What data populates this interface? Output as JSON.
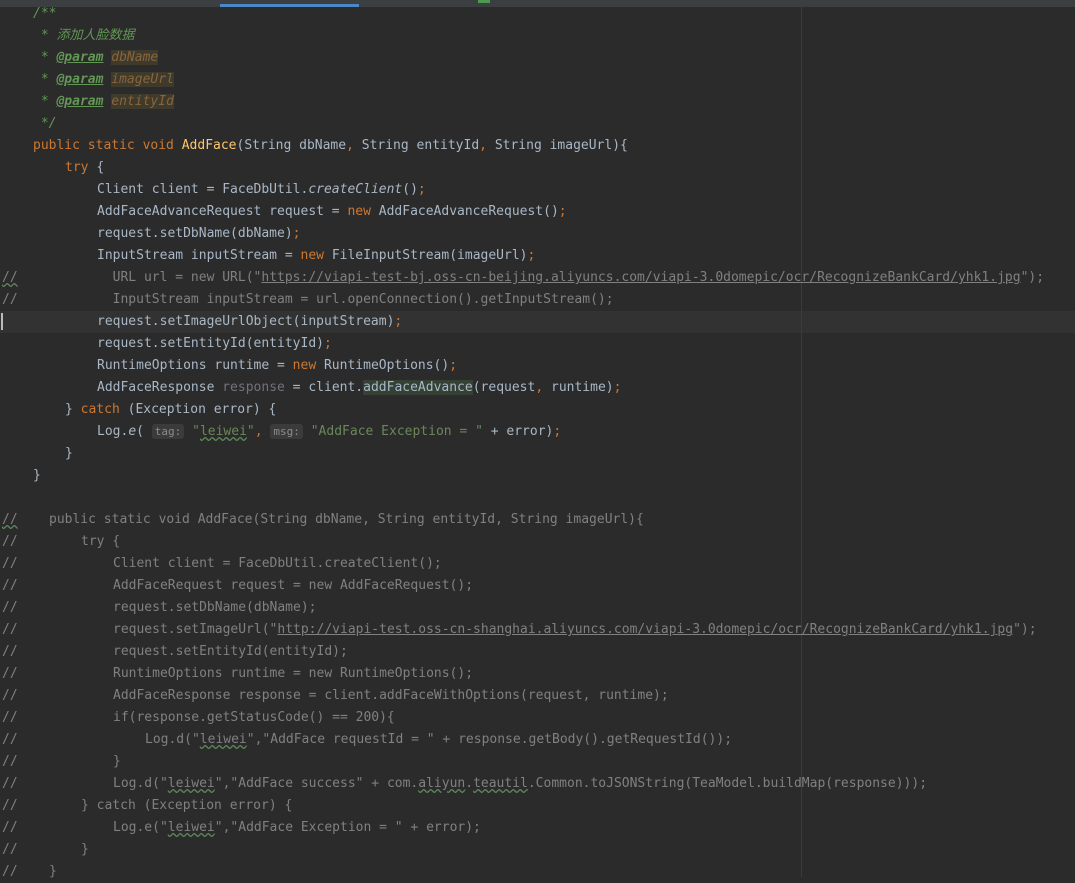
{
  "colors": {
    "background": "#2b2b2b",
    "keyword": "#cc7832",
    "function": "#ffc66d",
    "string": "#6a8759",
    "comment": "#808080",
    "doc": "#629755",
    "default": "#a9b7c6"
  },
  "code": {
    "doc_open": "/**",
    "doc_desc_prefix": " * ",
    "doc_desc": "添加人脸数据",
    "doc_star": " * ",
    "param_tag": "@param",
    "param1": "dbName",
    "param2": "imageUrl",
    "param3": "entityId",
    "doc_close": " */",
    "l6_kw": "public static void ",
    "l6_fn": "AddFace",
    "l6_a": "(String dbName",
    "l6_c1": ", ",
    "l6_b": "String entityId",
    "l6_c2": ", ",
    "l6_d": "String imageUrl){",
    "l7_kw": "try ",
    "l7_b": "{",
    "l8_a": "Client client = FaceDbUtil.",
    "l8_b": "createClient",
    "l8_c": "()",
    "l8_s": ";",
    "l9_a": "AddFaceAdvanceRequest request = ",
    "l9_kw": "new ",
    "l9_b": "AddFaceAdvanceRequest()",
    "l9_s": ";",
    "l10_a": "request.setDbName(dbName)",
    "l10_s": ";",
    "l11_a": "InputStream inputStream = ",
    "l11_kw": "new ",
    "l11_b": "FileInputStream(imageUrl)",
    "l11_s": ";",
    "l12_g": "//",
    "l12_a": "  URL url = new URL(\"",
    "l12_link": "https://viapi-test-bj.oss-cn-beijing.aliyuncs.com/viapi-3.0domepic/ocr/RecognizeBankCard/yhk1.jpg",
    "l12_b": "\");",
    "l13_g": "//",
    "l13_a": "  InputStream inputStream = url.openConnection().getInputStream();",
    "l14_a": "request.setImageUrlObject(inputStream)",
    "l14_s": ";",
    "l15_a": "request.setEntityId(entityId)",
    "l15_s": ";",
    "l16_a": "RuntimeOptions runtime = ",
    "l16_kw": "new ",
    "l16_b": "RuntimeOptions()",
    "l16_s": ";",
    "l17_a": "AddFaceResponse ",
    "l17_unused": "response",
    "l17_b": " = client.",
    "l17_hl": "addFaceAdvance",
    "l17_c": "(request",
    "l17_comma": ", ",
    "l17_d": "runtime)",
    "l17_s": ";",
    "l18_a": "} ",
    "l18_kw": "catch ",
    "l18_b": "(Exception error) {",
    "l19_a": "Log.",
    "l19_e": "e",
    "l19_b": "( ",
    "l19_hint1": "tag:",
    "l19_sp1": " ",
    "l19_q1": "\"",
    "l19_s1": "leiwei",
    "l19_q2": "\"",
    "l19_comma": ", ",
    "l19_hint2": "msg:",
    "l19_sp2": " ",
    "l19_s2": "\"AddFace Exception = \"",
    "l19_c": " + error)",
    "l19_s": ";",
    "l20": "}",
    "l21": "}",
    "c_gut": "//",
    "c1": "public static void AddFace(String dbName, String entityId, String imageUrl){",
    "c2": "try {",
    "c3": "Client client = FaceDbUtil.createClient();",
    "c4": "AddFaceRequest request = new AddFaceRequest();",
    "c5": "request.setDbName(dbName);",
    "c6_a": "request.setImageUrl(\"",
    "c6_link": "http://viapi-test.oss-cn-shanghai.aliyuncs.com/viapi-3.0domepic/ocr/RecognizeBankCard/yhk1.jpg",
    "c6_b": "\");",
    "c7": "request.setEntityId(entityId);",
    "c8": "RuntimeOptions runtime = new RuntimeOptions();",
    "c9": "AddFaceResponse response = client.addFaceWithOptions(request, runtime);",
    "c10": "if(response.getStatusCode() == 200){",
    "c11_a": "Log.d(\"",
    "c11_w": "leiwei",
    "c11_b": "\",\"AddFace requestId = \" + response.getBody().getRequestId());",
    "c12": "}",
    "c13_a": "Log.d(\"",
    "c13_w": "leiwei",
    "c13_b": "\",\"AddFace success\" + com.",
    "c13_w2": "aliyun",
    "c13_dot": ".",
    "c13_w3": "teautil",
    "c13_c": ".Common.toJSONString(TeaModel.buildMap(response)));",
    "c14": "} catch (Exception error) {",
    "c15_a": "Log.e(\"",
    "c15_w": "leiwei",
    "c15_b": "\",\"AddFace Exception = \" + error);",
    "c16": "}",
    "c17": "}"
  }
}
